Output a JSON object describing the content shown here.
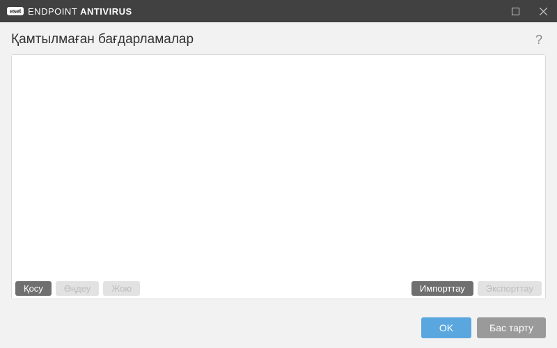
{
  "titlebar": {
    "brand_badge": "eset",
    "brand_text_light": "ENDPOINT ",
    "brand_text_bold": "ANTIVIRUS"
  },
  "page": {
    "title": "Қамтылмаған бағдарламалар",
    "help_symbol": "?"
  },
  "toolbar": {
    "add": "Қосу",
    "edit": "Өңдеу",
    "delete": "Жою",
    "import": "Импорттау",
    "export": "Экспорттау"
  },
  "footer": {
    "ok": "OK",
    "cancel": "Бас тарту"
  },
  "list": {
    "items": []
  }
}
